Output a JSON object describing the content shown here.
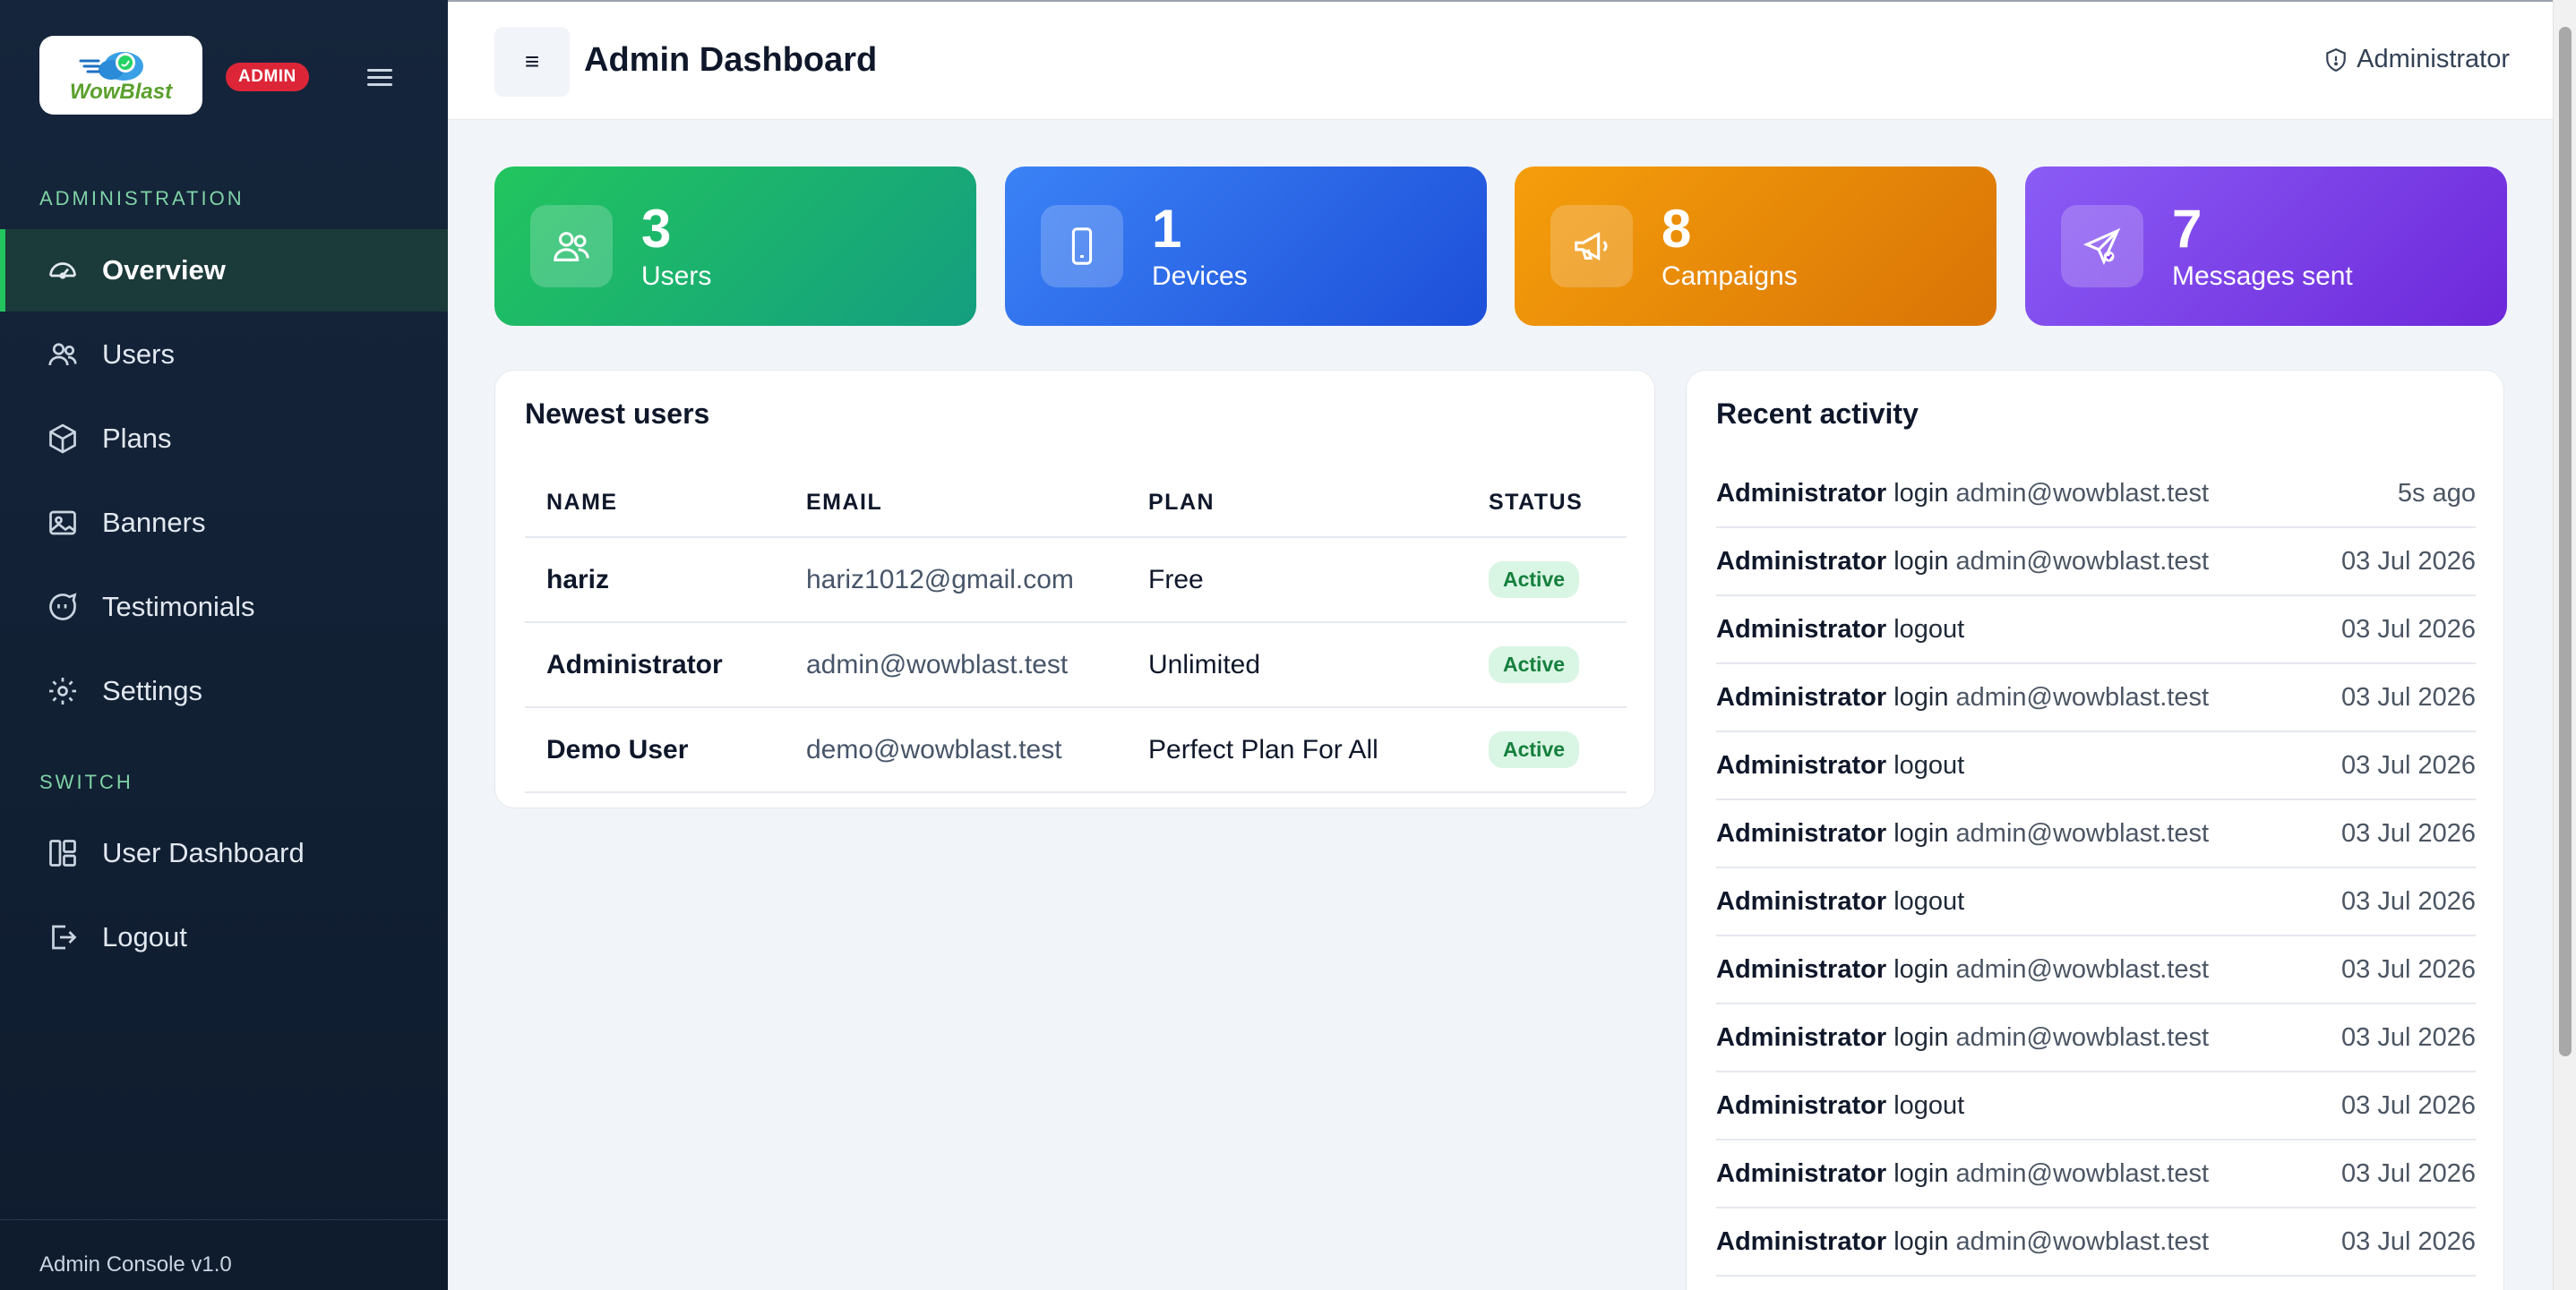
{
  "brand": {
    "logo_text": "WowBlast",
    "badge": "ADMIN"
  },
  "sidebar": {
    "sections": [
      {
        "label": "ADMINISTRATION"
      },
      {
        "label": "SWITCH"
      }
    ],
    "admin_items": [
      {
        "label": "Overview",
        "icon": "gauge-icon",
        "active": true
      },
      {
        "label": "Users",
        "icon": "users-icon"
      },
      {
        "label": "Plans",
        "icon": "box-icon"
      },
      {
        "label": "Banners",
        "icon": "image-icon"
      },
      {
        "label": "Testimonials",
        "icon": "chat-quote-icon"
      },
      {
        "label": "Settings",
        "icon": "gear-icon"
      }
    ],
    "switch_items": [
      {
        "label": "User Dashboard",
        "icon": "layout-icon"
      },
      {
        "label": "Logout",
        "icon": "logout-icon"
      }
    ],
    "footer": "Admin Console v1.0"
  },
  "header": {
    "toggle_glyph": "≡",
    "title": "Admin Dashboard",
    "user": "Administrator"
  },
  "stats": [
    {
      "value": "3",
      "label": "Users",
      "icon": "users-icon",
      "color": "#22c55e"
    },
    {
      "value": "1",
      "label": "Devices",
      "icon": "phone-icon",
      "color": "#3b82f6"
    },
    {
      "value": "8",
      "label": "Campaigns",
      "icon": "megaphone-icon",
      "color": "#f59e0b"
    },
    {
      "value": "7",
      "label": "Messages sent",
      "icon": "send-icon",
      "color": "#8b5cf6"
    }
  ],
  "newest_users": {
    "title": "Newest users",
    "columns": [
      "NAME",
      "EMAIL",
      "PLAN",
      "STATUS"
    ],
    "rows": [
      {
        "name": "hariz",
        "email": "hariz1012@gmail.com",
        "plan": "Free",
        "status": "Active"
      },
      {
        "name": "Administrator",
        "email": "admin@wowblast.test",
        "plan": "Unlimited",
        "status": "Active"
      },
      {
        "name": "Demo User",
        "email": "demo@wowblast.test",
        "plan": "Perfect Plan For All",
        "status": "Active"
      }
    ]
  },
  "recent_activity": {
    "title": "Recent activity",
    "items": [
      {
        "actor": "Administrator",
        "action": "login",
        "detail": "admin@wowblast.test",
        "time": "5s ago"
      },
      {
        "actor": "Administrator",
        "action": "login",
        "detail": "admin@wowblast.test",
        "time": "03 Jul 2026"
      },
      {
        "actor": "Administrator",
        "action": "logout",
        "detail": "",
        "time": "03 Jul 2026"
      },
      {
        "actor": "Administrator",
        "action": "login",
        "detail": "admin@wowblast.test",
        "time": "03 Jul 2026"
      },
      {
        "actor": "Administrator",
        "action": "logout",
        "detail": "",
        "time": "03 Jul 2026"
      },
      {
        "actor": "Administrator",
        "action": "login",
        "detail": "admin@wowblast.test",
        "time": "03 Jul 2026"
      },
      {
        "actor": "Administrator",
        "action": "logout",
        "detail": "",
        "time": "03 Jul 2026"
      },
      {
        "actor": "Administrator",
        "action": "login",
        "detail": "admin@wowblast.test",
        "time": "03 Jul 2026"
      },
      {
        "actor": "Administrator",
        "action": "login",
        "detail": "admin@wowblast.test",
        "time": "03 Jul 2026"
      },
      {
        "actor": "Administrator",
        "action": "logout",
        "detail": "",
        "time": "03 Jul 2026"
      },
      {
        "actor": "Administrator",
        "action": "login",
        "detail": "admin@wowblast.test",
        "time": "03 Jul 2026"
      },
      {
        "actor": "Administrator",
        "action": "login",
        "detail": "admin@wowblast.test",
        "time": "03 Jul 2026"
      }
    ]
  }
}
